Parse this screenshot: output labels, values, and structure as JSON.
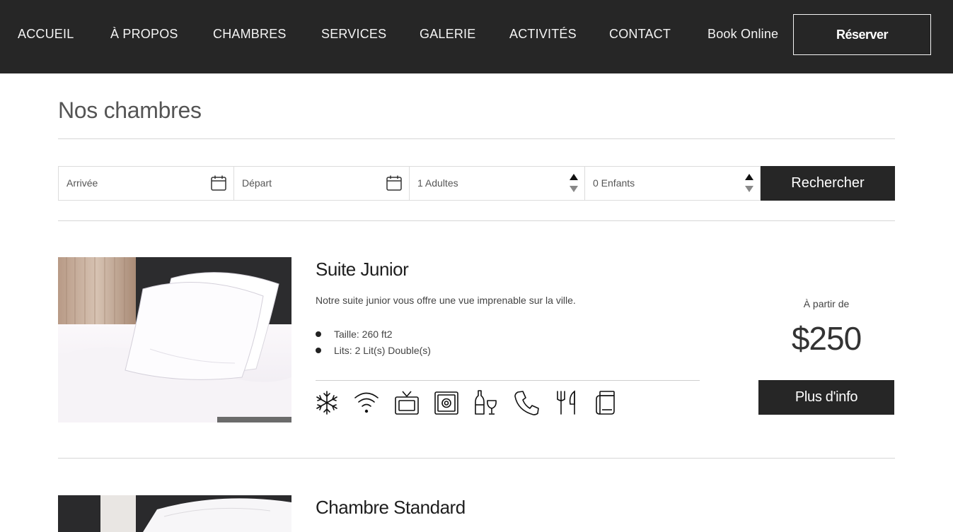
{
  "nav": {
    "items": [
      {
        "label": "ACCUEIL"
      },
      {
        "label": "À PROPOS"
      },
      {
        "label": "CHAMBRES"
      },
      {
        "label": "SERVICES"
      },
      {
        "label": "GALERIE"
      },
      {
        "label": "ACTIVITÉS"
      },
      {
        "label": "CONTACT"
      },
      {
        "label": "Book Online"
      }
    ],
    "reserve_label": "Réserver"
  },
  "page_title": "Nos chambres",
  "search": {
    "arrival_placeholder": "Arrivée",
    "departure_placeholder": "Départ",
    "adults_value": "1 Adultes",
    "children_value": "0 Enfants",
    "search_label": "Rechercher"
  },
  "rooms": [
    {
      "name": "Suite Junior",
      "description": "Notre suite junior vous offre une vue imprenable sur la ville.",
      "features": [
        "Taille: 260 ft2",
        "Lits: 2 Lit(s) Double(s)"
      ],
      "amenities": [
        "snowflake-icon",
        "wifi-icon",
        "tv-icon",
        "safe-icon",
        "minibar-icon",
        "phone-icon",
        "restaurant-icon",
        "towel-icon"
      ],
      "price_label": "À partir de",
      "price": "$250",
      "info_label": "Plus d'info"
    },
    {
      "name": "Chambre Standard"
    }
  ],
  "colors": {
    "nav_bg": "#262626",
    "button_bg": "#262626",
    "text": "#222222",
    "divider": "#d6d6d6"
  }
}
